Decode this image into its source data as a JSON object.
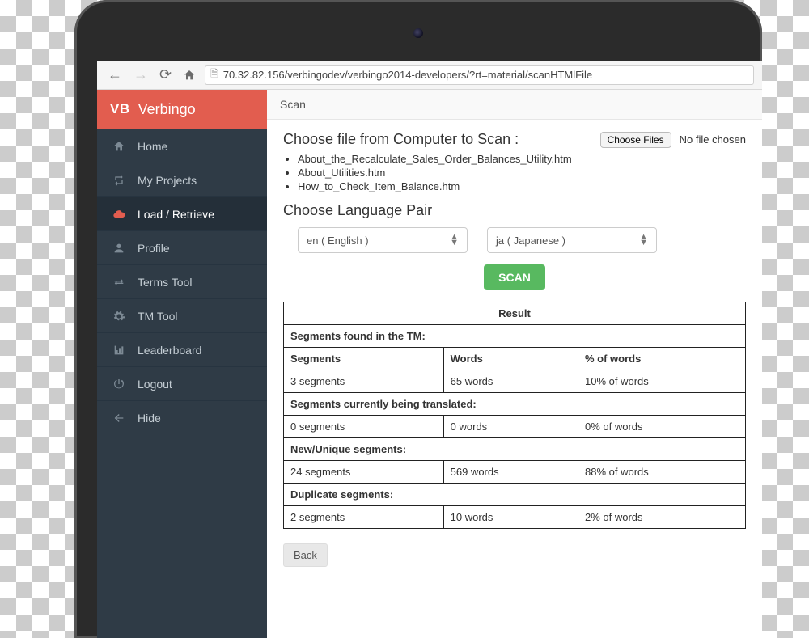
{
  "browser": {
    "url": "70.32.82.156/verbingodev/verbingo2014-developers/?rt=material/scanHTMlFile"
  },
  "brand": {
    "logo": "VB",
    "name": "Verbingo"
  },
  "sidebar": {
    "items": [
      {
        "label": "Home"
      },
      {
        "label": "My Projects"
      },
      {
        "label": "Load / Retrieve"
      },
      {
        "label": "Profile"
      },
      {
        "label": "Terms Tool"
      },
      {
        "label": "TM Tool"
      },
      {
        "label": "Leaderboard"
      },
      {
        "label": "Logout"
      },
      {
        "label": "Hide"
      }
    ]
  },
  "page": {
    "title": "Scan",
    "chooseLabel": "Choose file from Computer to Scan :",
    "chooseFilesBtn": "Choose Files",
    "fileStatus": "No file chosen",
    "files": [
      "About_the_Recalculate_Sales_Order_Balances_Utility.htm",
      "About_Utilities.htm",
      "How_to_Check_Item_Balance.htm"
    ],
    "langPairLabel": "Choose Language Pair",
    "sourceLang": "en ( English )",
    "targetLang": "ja ( Japanese )",
    "scanBtn": "SCAN",
    "backBtn": "Back"
  },
  "result": {
    "title": "Result",
    "sections": [
      {
        "title": "Segments found in the TM:",
        "headers": [
          "Segments",
          "Words",
          "% of words"
        ],
        "row": [
          "3 segments",
          "65 words",
          "10% of words"
        ]
      },
      {
        "title": "Segments currently being translated:",
        "row": [
          "0 segments",
          "0 words",
          "0% of words"
        ]
      },
      {
        "title": "New/Unique segments:",
        "row": [
          "24 segments",
          "569 words",
          "88% of words"
        ]
      },
      {
        "title": "Duplicate segments:",
        "row": [
          "2 segments",
          "10 words",
          "2% of words"
        ]
      }
    ]
  },
  "colors": {
    "brand": "#e25d4f",
    "sidebar": "#2f3b46",
    "scan": "#58b960"
  }
}
